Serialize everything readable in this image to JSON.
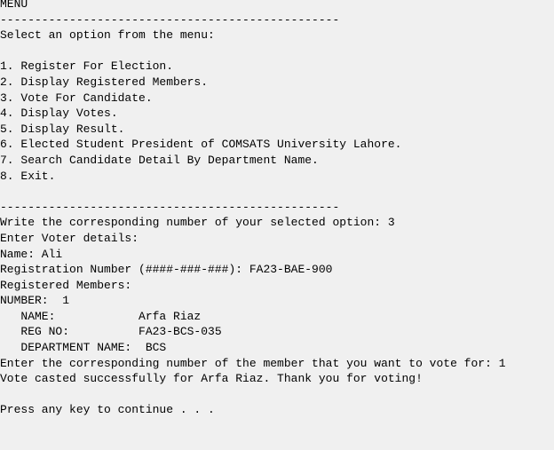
{
  "console": {
    "lines": [
      "MENU",
      "-------------------------------------------------",
      "Select an option from the menu:",
      "",
      "1. Register For Election.",
      "2. Display Registered Members.",
      "3. Vote For Candidate.",
      "4. Display Votes.",
      "5. Display Result.",
      "6. Elected Student President of COMSATS University Lahore.",
      "7. Search Candidate Detail By Department Name.",
      "8. Exit.",
      "",
      "-------------------------------------------------",
      "Write the corresponding number of your selected option: 3",
      "Enter Voter details:",
      "Name: Ali",
      "Registration Number (####-###-###): FA23-BAE-900",
      "Registered Members:",
      "NUMBER:  1",
      "   NAME:            Arfa Riaz",
      "   REG NO:          FA23-BCS-035",
      "   DEPARTMENT NAME:  BCS",
      "Enter the corresponding number of the member that you want to vote for: 1",
      "Vote casted successfully for Arfa Riaz. Thank you for voting!",
      "",
      "Press any key to continue . . ."
    ]
  }
}
